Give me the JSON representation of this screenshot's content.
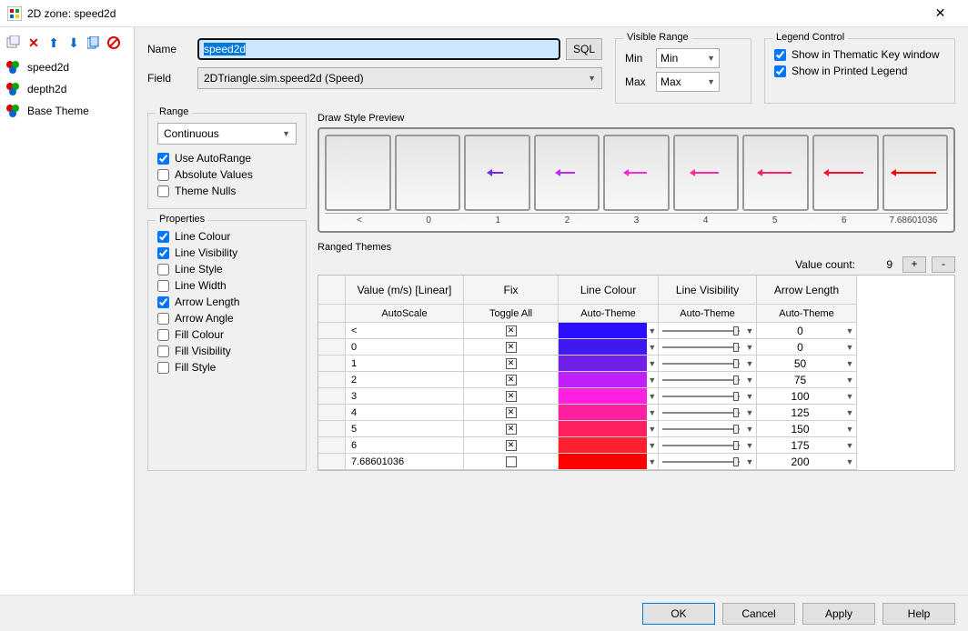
{
  "window": {
    "title": "2D zone: speed2d"
  },
  "sidebar": {
    "items": [
      {
        "label": "speed2d"
      },
      {
        "label": "depth2d"
      },
      {
        "label": "Base Theme"
      }
    ]
  },
  "form": {
    "name_label": "Name",
    "name_value": "speed2d",
    "sql_label": "SQL",
    "field_label": "Field",
    "field_value": "2DTriangle.sim.speed2d (Speed)"
  },
  "visible_range": {
    "title": "Visible Range",
    "min_label": "Min",
    "min_value": "Min",
    "max_label": "Max",
    "max_value": "Max"
  },
  "legend_control": {
    "title": "Legend Control",
    "opt1": "Show in Thematic Key window",
    "opt2": "Show in Printed Legend"
  },
  "range": {
    "title": "Range",
    "mode": "Continuous",
    "auto": "Use AutoRange",
    "abs": "Absolute Values",
    "nulls": "Theme Nulls"
  },
  "properties": {
    "title": "Properties",
    "items": [
      {
        "label": "Line Colour",
        "checked": true
      },
      {
        "label": "Line Visibility",
        "checked": true
      },
      {
        "label": "Line Style",
        "checked": false
      },
      {
        "label": "Line Width",
        "checked": false
      },
      {
        "label": "Arrow Length",
        "checked": true
      },
      {
        "label": "Arrow Angle",
        "checked": false
      },
      {
        "label": "Fill Colour",
        "checked": false
      },
      {
        "label": "Fill Visibility",
        "checked": false
      },
      {
        "label": "Fill Style",
        "checked": false
      }
    ]
  },
  "preview": {
    "title": "Draw Style Preview",
    "ticks": [
      "<",
      "0",
      "1",
      "2",
      "3",
      "4",
      "5",
      "6",
      "7.68601036"
    ],
    "arrows": [
      {
        "len": 0,
        "color": "#3a1fd8"
      },
      {
        "len": 0,
        "color": "#3a1fd8"
      },
      {
        "len": 14,
        "color": "#6b2fe0"
      },
      {
        "len": 18,
        "color": "#c028ff"
      },
      {
        "len": 22,
        "color": "#ff28d8"
      },
      {
        "len": 28,
        "color": "#ff2aa0"
      },
      {
        "len": 34,
        "color": "#ff2060"
      },
      {
        "len": 40,
        "color": "#ff1030"
      },
      {
        "len": 46,
        "color": "#ff0000"
      }
    ]
  },
  "ranged": {
    "title": "Ranged Themes",
    "value_count_label": "Value count:",
    "value_count": "9",
    "plus": "+",
    "minus": "-",
    "headers": {
      "value": "Value (m/s) [Linear]",
      "fix": "Fix",
      "colour": "Line Colour",
      "visibility": "Line Visibility",
      "arrow": "Arrow Length"
    },
    "sub": {
      "value": "AutoScale",
      "fix": "Toggle All",
      "colour": "Auto-Theme",
      "visibility": "Auto-Theme",
      "arrow": "Auto-Theme"
    },
    "rows": [
      {
        "value": "<",
        "fix": true,
        "color": "#2a10ff",
        "vis": 100,
        "arrow": "0"
      },
      {
        "value": "0",
        "fix": true,
        "color": "#4018f0",
        "vis": 100,
        "arrow": "0"
      },
      {
        "value": "1",
        "fix": true,
        "color": "#7020e8",
        "vis": 100,
        "arrow": "50"
      },
      {
        "value": "2",
        "fix": true,
        "color": "#c020ff",
        "vis": 100,
        "arrow": "75"
      },
      {
        "value": "3",
        "fix": true,
        "color": "#ff20e0",
        "vis": 100,
        "arrow": "100"
      },
      {
        "value": "4",
        "fix": true,
        "color": "#ff20a0",
        "vis": 100,
        "arrow": "125"
      },
      {
        "value": "5",
        "fix": true,
        "color": "#ff2060",
        "vis": 100,
        "arrow": "150"
      },
      {
        "value": "6",
        "fix": true,
        "color": "#ff2030",
        "vis": 100,
        "arrow": "175"
      },
      {
        "value": "7.68601036",
        "fix": false,
        "color": "#ff0000",
        "vis": 100,
        "arrow": "200"
      }
    ]
  },
  "footer": {
    "ok": "OK",
    "cancel": "Cancel",
    "apply": "Apply",
    "help": "Help"
  }
}
